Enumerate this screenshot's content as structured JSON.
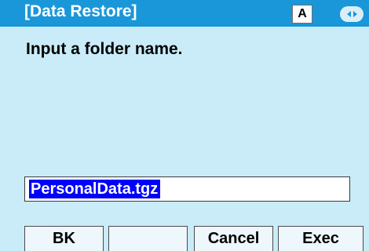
{
  "titlebar": {
    "title": "[Data Restore]",
    "mode_indicator": "A",
    "nav_icon": "left-right-arrows-icon"
  },
  "main": {
    "prompt": "Input a folder name.",
    "input_value": "PersonalData.tgz"
  },
  "softkeys": {
    "key1": "BK",
    "key2": "",
    "key3": "Cancel",
    "key4": "Exec"
  },
  "colors": {
    "titlebar_bg": "#1a97d8",
    "screen_bg": "#c9ecf8",
    "selection_bg": "#0000ff"
  }
}
